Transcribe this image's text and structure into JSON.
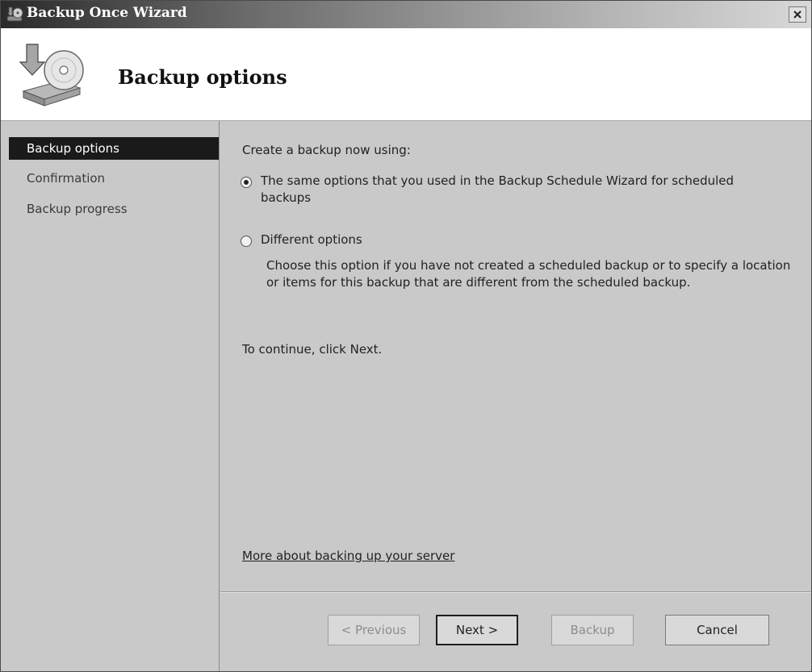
{
  "window": {
    "title": "Backup Once Wizard"
  },
  "header": {
    "heading": "Backup options"
  },
  "sidebar": {
    "items": [
      {
        "label": "Backup options",
        "active": true
      },
      {
        "label": "Confirmation",
        "active": false
      },
      {
        "label": "Backup progress",
        "active": false
      }
    ]
  },
  "main": {
    "prompt": "Create a backup now using:",
    "option_same": "The same options that you used in the Backup Schedule Wizard for scheduled backups",
    "option_different": "Different options",
    "option_different_desc": "Choose this option if you have not created a scheduled backup or to specify a location or items for this backup that are different from the scheduled backup.",
    "continue_text": "To continue, click Next.",
    "more_link": "More about backing up your server"
  },
  "buttons": {
    "previous": "< Previous",
    "next": "Next >",
    "backup": "Backup",
    "cancel": "Cancel"
  }
}
